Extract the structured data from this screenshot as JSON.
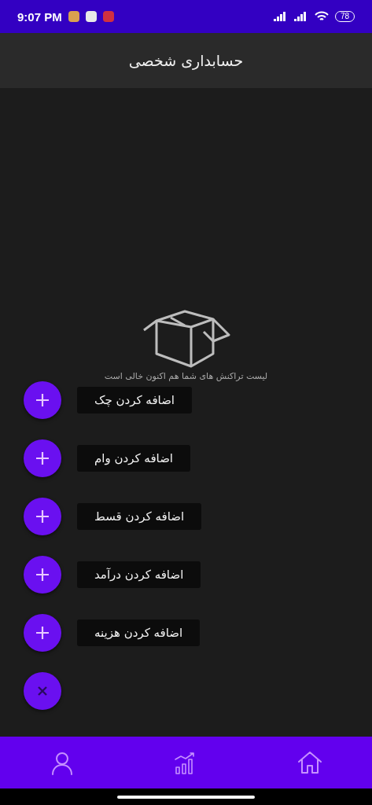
{
  "status_bar": {
    "time": "9:07 PM",
    "battery": "78"
  },
  "header": {
    "title": "حسابداری شخصی"
  },
  "empty_state": {
    "message": "لیست تراکنش های شما هم اکنون خالی است"
  },
  "fab_actions": [
    {
      "label": "اضافه کردن چک"
    },
    {
      "label": "اضافه کردن وام"
    },
    {
      "label": "اضافه کردن قسط"
    },
    {
      "label": "اضافه کردن درآمد"
    },
    {
      "label": "اضافه کردن هزینه"
    }
  ],
  "bottom_nav": [
    {
      "kind": "profile"
    },
    {
      "kind": "stats"
    },
    {
      "kind": "home"
    }
  ]
}
